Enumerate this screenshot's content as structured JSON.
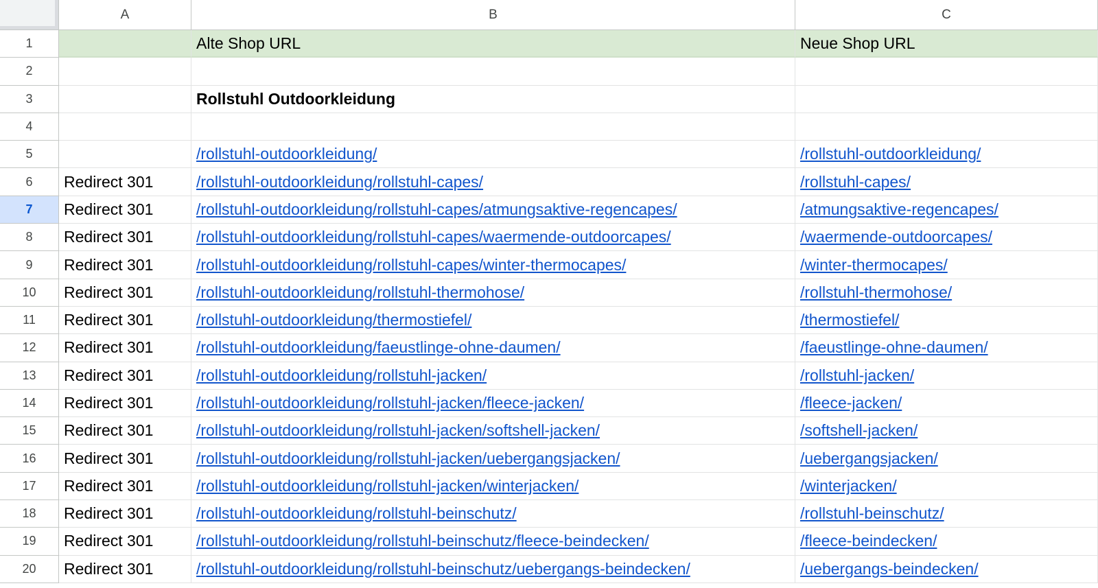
{
  "columns": [
    "A",
    "B",
    "C"
  ],
  "rows": [
    {
      "num": "1",
      "a": "",
      "b": "Alte Shop URL",
      "c": "Neue Shop URL",
      "header": true
    },
    {
      "num": "2",
      "a": "",
      "b": "",
      "c": ""
    },
    {
      "num": "3",
      "a": "",
      "b": "Rollstuhl Outdoorkleidung",
      "c": "",
      "bold": true
    },
    {
      "num": "4",
      "a": "",
      "b": "",
      "c": ""
    },
    {
      "num": "5",
      "a": "",
      "b": "/rollstuhl-outdoorkleidung/",
      "c": "/rollstuhl-outdoorkleidung/",
      "link": true
    },
    {
      "num": "6",
      "a": "Redirect 301",
      "b": "/rollstuhl-outdoorkleidung/rollstuhl-capes/",
      "c": "/rollstuhl-capes/",
      "link": true
    },
    {
      "num": "7",
      "a": "Redirect 301",
      "b": "/rollstuhl-outdoorkleidung/rollstuhl-capes/atmungsaktive-regencapes/",
      "c": "/atmungsaktive-regencapes/",
      "link": true,
      "selected": true
    },
    {
      "num": "8",
      "a": "Redirect 301",
      "b": "/rollstuhl-outdoorkleidung/rollstuhl-capes/waermende-outdoorcapes/",
      "c": "/waermende-outdoorcapes/",
      "link": true
    },
    {
      "num": "9",
      "a": "Redirect 301",
      "b": "/rollstuhl-outdoorkleidung/rollstuhl-capes/winter-thermocapes/",
      "c": "/winter-thermocapes/",
      "link": true
    },
    {
      "num": "10",
      "a": "Redirect 301",
      "b": "/rollstuhl-outdoorkleidung/rollstuhl-thermohose/",
      "c": "/rollstuhl-thermohose/",
      "link": true
    },
    {
      "num": "11",
      "a": "Redirect 301",
      "b": "/rollstuhl-outdoorkleidung/thermostiefel/",
      "c": "/thermostiefel/",
      "link": true
    },
    {
      "num": "12",
      "a": "Redirect 301",
      "b": "/rollstuhl-outdoorkleidung/faeustlinge-ohne-daumen/",
      "c": "/faeustlinge-ohne-daumen/",
      "link": true
    },
    {
      "num": "13",
      "a": "Redirect 301",
      "b": "/rollstuhl-outdoorkleidung/rollstuhl-jacken/",
      "c": "/rollstuhl-jacken/",
      "link": true
    },
    {
      "num": "14",
      "a": "Redirect 301",
      "b": "/rollstuhl-outdoorkleidung/rollstuhl-jacken/fleece-jacken/",
      "c": "/fleece-jacken/",
      "link": true
    },
    {
      "num": "15",
      "a": "Redirect 301",
      "b": "/rollstuhl-outdoorkleidung/rollstuhl-jacken/softshell-jacken/",
      "c": "/softshell-jacken/",
      "link": true
    },
    {
      "num": "16",
      "a": "Redirect 301",
      "b": "/rollstuhl-outdoorkleidung/rollstuhl-jacken/uebergangsjacken/",
      "c": "/uebergangsjacken/",
      "link": true
    },
    {
      "num": "17",
      "a": "Redirect 301",
      "b": "/rollstuhl-outdoorkleidung/rollstuhl-jacken/winterjacken/",
      "c": "/winterjacken/",
      "link": true
    },
    {
      "num": "18",
      "a": "Redirect 301",
      "b": "/rollstuhl-outdoorkleidung/rollstuhl-beinschutz/",
      "c": "/rollstuhl-beinschutz/",
      "link": true
    },
    {
      "num": "19",
      "a": "Redirect 301",
      "b": "/rollstuhl-outdoorkleidung/rollstuhl-beinschutz/fleece-beindecken/",
      "c": "/fleece-beindecken/",
      "link": true
    },
    {
      "num": "20",
      "a": "Redirect 301",
      "b": "/rollstuhl-outdoorkleidung/rollstuhl-beinschutz/uebergangs-beindecken/",
      "c": "/uebergangs-beindecken/",
      "link": true
    }
  ],
  "colors": {
    "header_row_fill": "#d9ead3",
    "link": "#1155cc",
    "selected_row_header": "#d3e3fd",
    "gridline": "#e2e3e3"
  }
}
